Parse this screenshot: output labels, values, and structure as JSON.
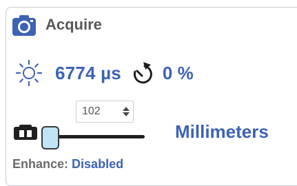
{
  "header": {
    "title": "Acquire",
    "icon": "camera-icon"
  },
  "stats": {
    "exposure": "6774 µs",
    "exposure_icon": "sun-icon",
    "gain": "0 %",
    "gain_icon": "gauge-icon"
  },
  "focus": {
    "stepper_value": "102",
    "slider_position": 0,
    "units": "Millimeters",
    "icon": "aperture-icon"
  },
  "enhance": {
    "label": "Enhance:",
    "value": "Disabled"
  },
  "colors": {
    "accent": "#3d63b6",
    "label": "#595959",
    "border": "#c9ccd1",
    "thumb": "#bfe5f5"
  }
}
